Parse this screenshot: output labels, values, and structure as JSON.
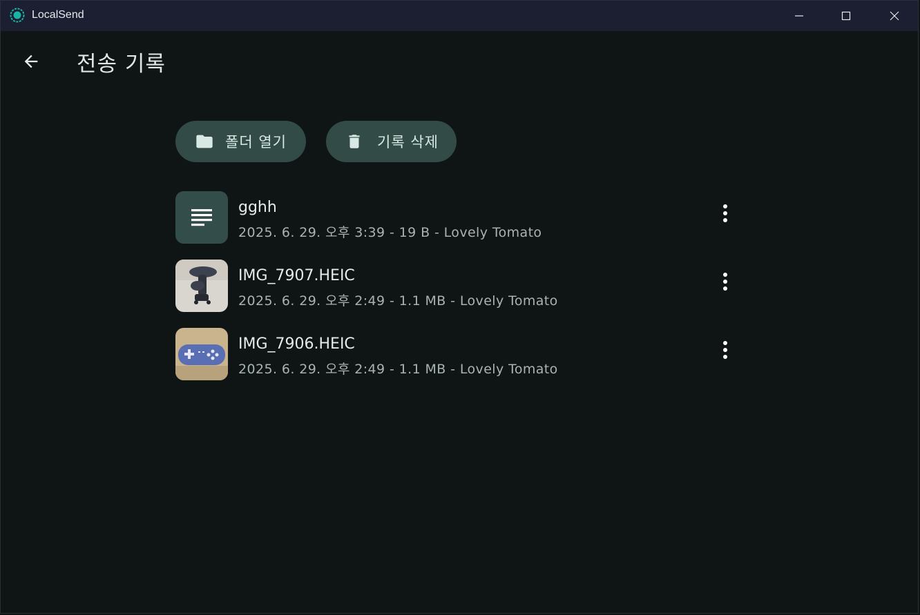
{
  "window": {
    "title": "LocalSend",
    "accent": "#1bb3a6"
  },
  "page": {
    "title": "전송 기록"
  },
  "actions": {
    "open_folder_label": "폴더 열기",
    "delete_history_label": "기록 삭제"
  },
  "items": [
    {
      "name": "gghh",
      "meta": "2025. 6. 29. 오후 3:39 - 19 B - Lovely Tomato",
      "icon": "text-file-icon"
    },
    {
      "name": "IMG_7907.HEIC",
      "meta": "2025. 6. 29. 오후 2:49 - 1.1 MB - Lovely Tomato",
      "icon": "image-thumbnail"
    },
    {
      "name": "IMG_7906.HEIC",
      "meta": "2025. 6. 29. 오후 2:49 - 1.1 MB - Lovely Tomato",
      "icon": "image-thumbnail"
    }
  ],
  "colors": {
    "background": "#0f1514",
    "titlebar": "#1b1f31",
    "button": "#324b47"
  }
}
